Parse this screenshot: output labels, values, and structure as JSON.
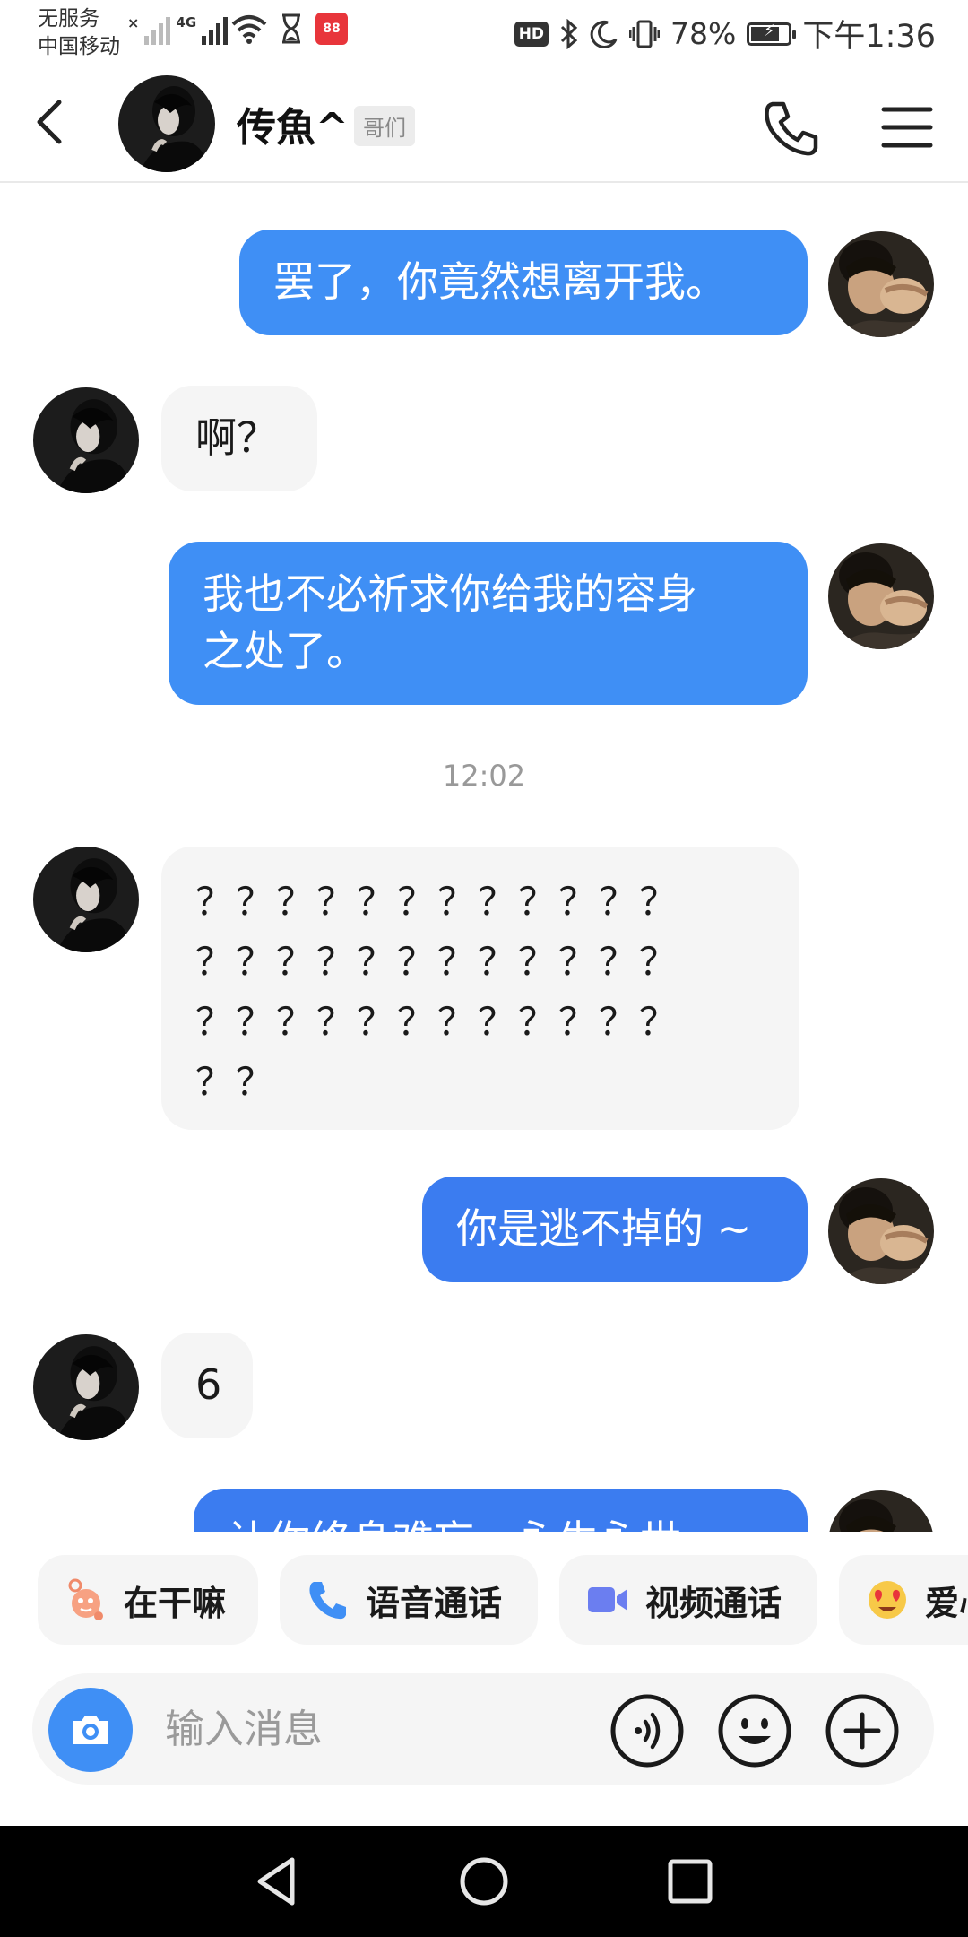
{
  "status_bar": {
    "carrier_line1": "无服务",
    "carrier_line2": "中国移动",
    "network": "4G",
    "battery_percent": "78%",
    "battery_level": 0.78,
    "time": "下午1:36",
    "hd_label": "HD"
  },
  "header": {
    "contact_name": "传魚^",
    "relation_tag": "哥们"
  },
  "messages": [
    {
      "sender": "me",
      "text": "罢了，你竟然想离开我。"
    },
    {
      "sender": "them",
      "text": "啊？"
    },
    {
      "sender": "me",
      "lines": [
        "我也不必祈求你给我的容身",
        "之处了。"
      ]
    },
    {
      "timestamp": "12:02"
    },
    {
      "sender": "them",
      "lines": [
        "？？？？？？？？？？？？",
        "？？？？？？？？？？？？",
        "？？？？？？？？？？？？",
        "？？"
      ]
    },
    {
      "sender": "me",
      "text": "你是逃不掉的 ~"
    },
    {
      "sender": "them",
      "text": "6"
    },
    {
      "sender": "me",
      "text": "让你终身难忘，永生永世"
    }
  ],
  "quick_actions": [
    {
      "label": "在干嘛",
      "icon": "wave-icon"
    },
    {
      "label": "语音通话",
      "icon": "phone-icon"
    },
    {
      "label": "视频通话",
      "icon": "video-icon"
    },
    {
      "label": "爱心",
      "icon": "heart-eyes-icon"
    }
  ],
  "input_bar": {
    "placeholder": "输入消息"
  },
  "colors": {
    "accent_blue": "#3f8ff5",
    "bubble_gray": "#f5f5f5"
  }
}
